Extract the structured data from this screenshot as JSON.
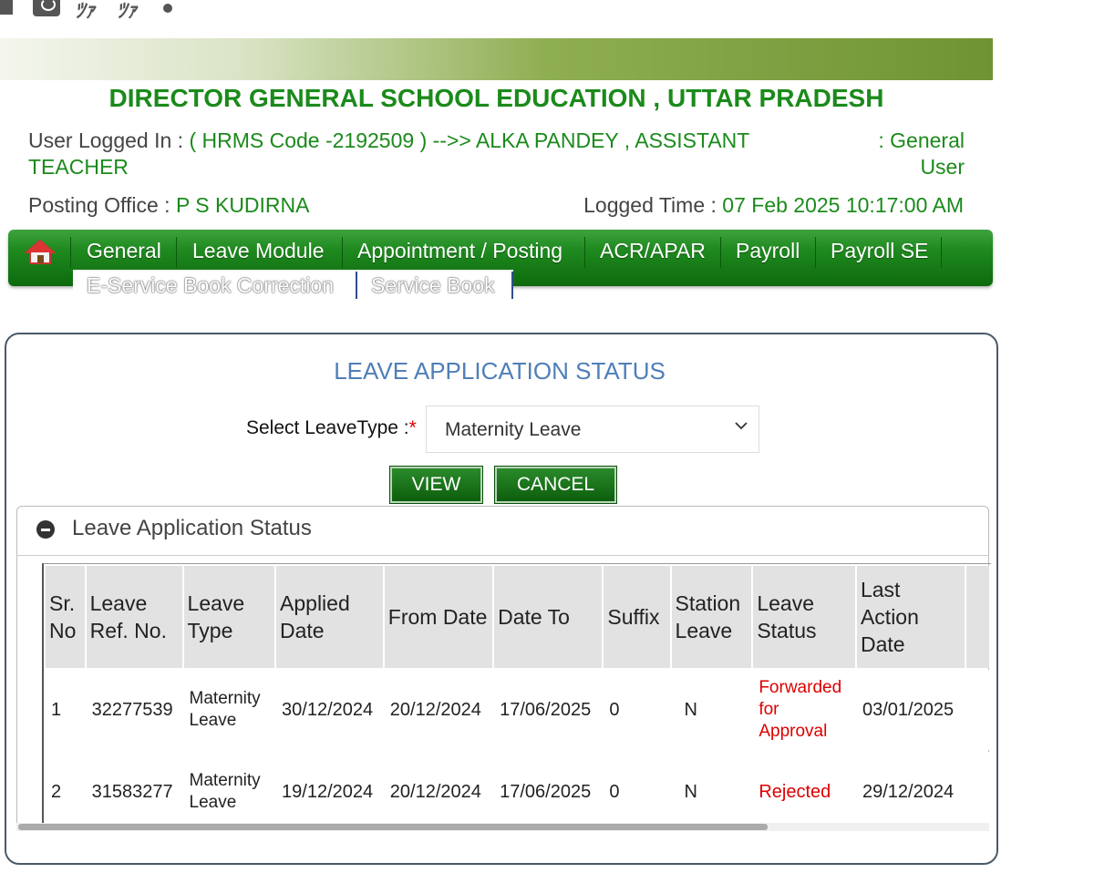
{
  "header": {
    "title": "DIRECTOR GENERAL SCHOOL EDUCATION , UTTAR PRADESH",
    "user_label": "User Logged In : ",
    "user_value": "( HRMS Code -2192509 ) -->> ALKA PANDEY , ASSISTANT TEACHER",
    "user_type": ": General User",
    "posting_label": "Posting Office : ",
    "posting_value": "P S KUDIRNA",
    "logged_label": "Logged Time : ",
    "logged_value": "07 Feb 2025 10:17:00 AM"
  },
  "nav": {
    "items": [
      "General",
      "Leave Module",
      "Appointment / Posting",
      "ACR/APAR",
      "Payroll",
      "Payroll SE"
    ],
    "row2": [
      "E-Service Book Correction",
      "Service Book"
    ]
  },
  "page": {
    "title": "LEAVE APPLICATION STATUS",
    "select_label": "Select LeaveType :",
    "required_mark": "*",
    "select_value": "Maternity Leave",
    "view_label": "VIEW",
    "cancel_label": "CANCEL",
    "section_title": "Leave Application Status"
  },
  "table": {
    "headers": [
      "Sr. No",
      "Leave Ref. No.",
      "Leave Type",
      "Applied Date",
      "From Date",
      "Date To",
      "Suffix",
      "Station Leave",
      "Leave Status",
      "Last Action Date"
    ],
    "rows": [
      [
        "1",
        "32277539",
        "Maternity Leave",
        "30/12/2024",
        "20/12/2024",
        "17/06/2025",
        "0",
        "N",
        "Forwarded for Approval",
        "03/01/2025"
      ],
      [
        "2",
        "31583277",
        "Maternity Leave",
        "19/12/2024",
        "20/12/2024",
        "17/06/2025",
        "0",
        "N",
        "Rejected",
        "29/12/2024"
      ]
    ]
  },
  "colors": {
    "brand_green": "#1b8a1b",
    "title_blue": "#4f7fb8",
    "status_red": "#dd0000"
  },
  "icons": [
    "home-icon",
    "chevron-down-icon",
    "collapse-icon"
  ]
}
